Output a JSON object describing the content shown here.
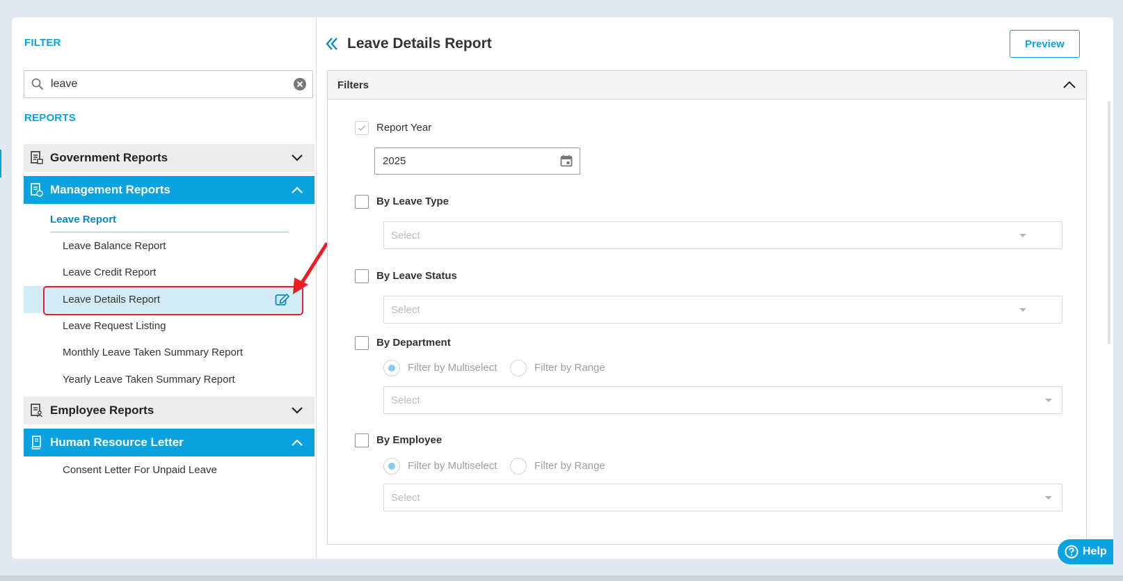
{
  "sidebar": {
    "filter_label": "FILTER",
    "search": {
      "value": "leave",
      "placeholder": ""
    },
    "reports_label": "REPORTS",
    "categories": [
      {
        "label": "Government Reports",
        "expanded": false
      },
      {
        "label": "Management Reports",
        "expanded": true
      },
      {
        "label": "Employee Reports",
        "expanded": false
      },
      {
        "label": "Human Resource Letter",
        "expanded": true
      }
    ],
    "group_label": "Leave Report",
    "leave_items": [
      "Leave Balance Report",
      "Leave Credit Report",
      "Leave Details Report",
      "Leave Request Listing",
      "Monthly Leave Taken Summary Report",
      "Yearly Leave Taken Summary Report"
    ],
    "hr_items": [
      "Consent Letter For Unpaid Leave"
    ]
  },
  "main": {
    "title": "Leave Details Report",
    "preview_label": "Preview",
    "filters": {
      "header": "Filters",
      "report_year": {
        "label": "Report Year",
        "checked": true,
        "value": "2025"
      },
      "by_leave_type": {
        "label": "By Leave Type",
        "checked": false,
        "placeholder": "Select"
      },
      "by_leave_status": {
        "label": "By Leave Status",
        "checked": false,
        "placeholder": "Select"
      },
      "by_department": {
        "label": "By Department",
        "checked": false,
        "radio_multi": "Filter by Multiselect",
        "radio_range": "Filter by Range",
        "placeholder": "Select"
      },
      "by_employee": {
        "label": "By Employee",
        "checked": false,
        "radio_multi": "Filter by Multiselect",
        "radio_range": "Filter by Range",
        "placeholder": "Select"
      }
    }
  },
  "help_label": "Help",
  "colors": {
    "accent": "#0aa3e0",
    "highlight": "#d3ecf8",
    "annotation": "#ee1d23"
  }
}
